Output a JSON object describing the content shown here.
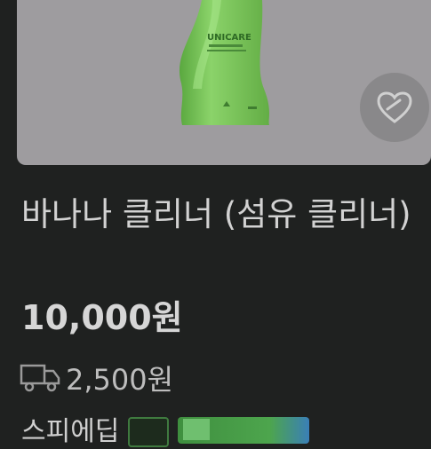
{
  "product": {
    "title": "바나나 클리너 (섬유 클리너)",
    "price": "10,000원",
    "shipping_fee": "2,500원",
    "image_brand": "UNICARE"
  },
  "trade_option": {
    "label": "스피에딥"
  },
  "icons": {
    "like": "heart-icon",
    "shipping": "truck-icon"
  },
  "colors": {
    "background": "#1f2120",
    "image_background": "#9e9c9f",
    "bottle_green": "#74c255"
  }
}
